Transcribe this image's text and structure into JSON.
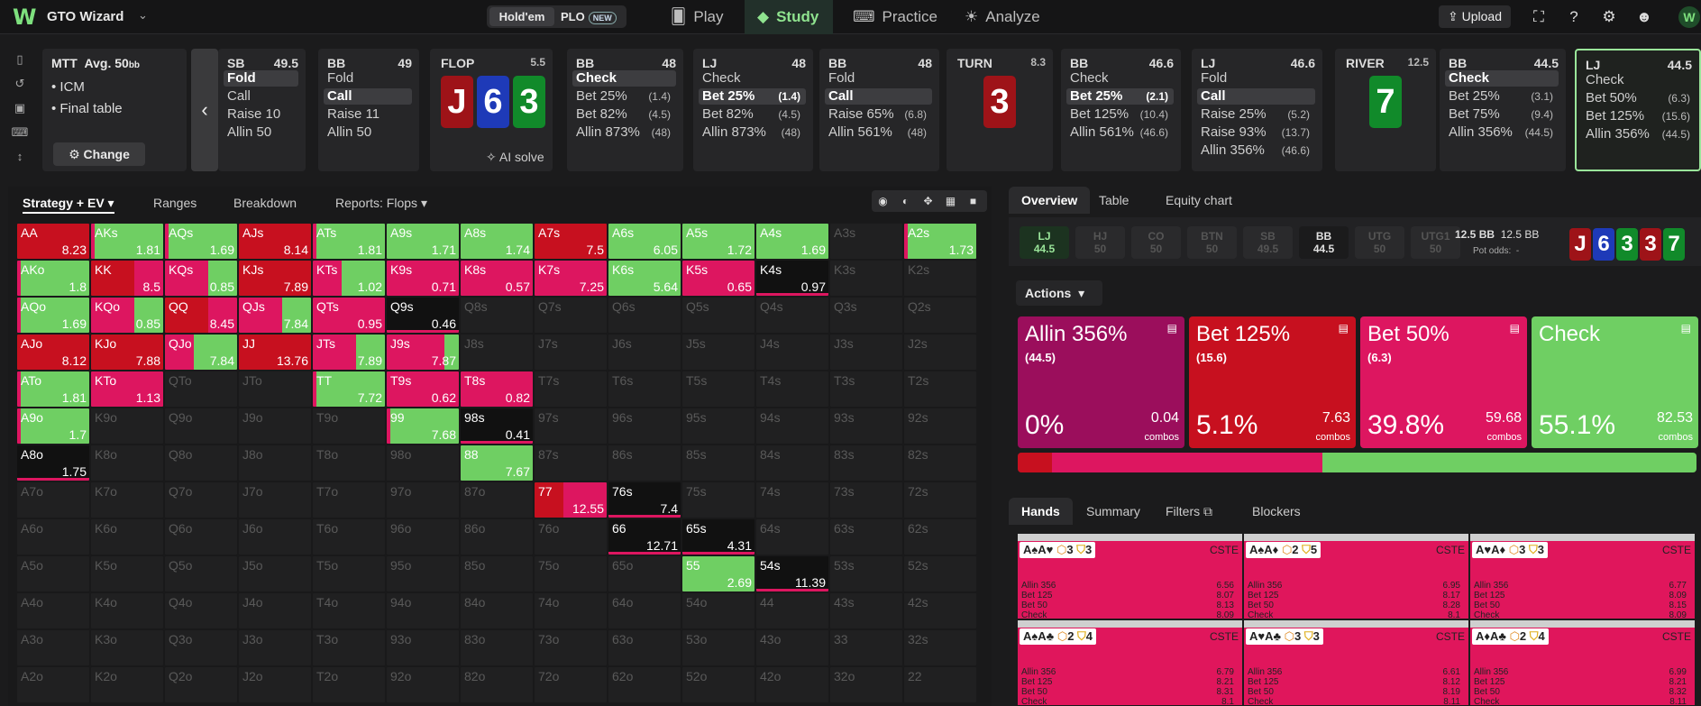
{
  "topbar": {
    "app_title": "GTO Wizard",
    "mode_holdem": "Hold'em",
    "mode_plo": "PLO",
    "new_badge": "NEW",
    "nav": [
      {
        "label": "Play",
        "icon": "cards-icon"
      },
      {
        "label": "Study",
        "icon": "graduation-cap-icon"
      },
      {
        "label": "Practice",
        "icon": "gamepad-icon"
      },
      {
        "label": "Analyze",
        "icon": "lightbulb-icon"
      }
    ],
    "upload": "Upload"
  },
  "mtt": {
    "line1_a": "MTT",
    "line1_b": "Avg. 50",
    "line1_unit": "bb",
    "bullet1": "ICM",
    "bullet2": "Final table",
    "change": "Change"
  },
  "preflop_cards": [
    {
      "name": "SB",
      "stack": "49.5",
      "options": [
        {
          "label": "Fold",
          "amt": "",
          "sel": true
        },
        {
          "label": "Call",
          "amt": "",
          "sel": false
        },
        {
          "label": "Raise 10",
          "amt": "",
          "sel": false
        },
        {
          "label": "Allin 50",
          "amt": "",
          "sel": false
        }
      ]
    },
    {
      "name": "BB",
      "stack": "49",
      "options": [
        {
          "label": "Fold",
          "amt": "",
          "sel": false
        },
        {
          "label": "Call",
          "amt": "",
          "sel": true
        },
        {
          "label": "Raise 11",
          "amt": "",
          "sel": false
        },
        {
          "label": "Allin 50",
          "amt": "",
          "sel": false
        }
      ]
    }
  ],
  "flop": {
    "title": "FLOP",
    "pot": "5.5",
    "cards": [
      "J",
      "6",
      "3"
    ],
    "ai_solve": "AI solve"
  },
  "flop_cards": [
    {
      "name": "BB",
      "stack": "48",
      "options": [
        {
          "label": "Check",
          "amt": "",
          "sel": true
        },
        {
          "label": "Bet 25%",
          "amt": "(1.4)",
          "sel": false
        },
        {
          "label": "Bet 82%",
          "amt": "(4.5)",
          "sel": false
        },
        {
          "label": "Allin 873%",
          "amt": "(48)",
          "sel": false
        }
      ]
    },
    {
      "name": "LJ",
      "stack": "48",
      "options": [
        {
          "label": "Check",
          "amt": "",
          "sel": false
        },
        {
          "label": "Bet 25%",
          "amt": "(1.4)",
          "sel": true
        },
        {
          "label": "Bet 82%",
          "amt": "(4.5)",
          "sel": false
        },
        {
          "label": "Allin 873%",
          "amt": "(48)",
          "sel": false
        }
      ]
    },
    {
      "name": "BB",
      "stack": "48",
      "options": [
        {
          "label": "Fold",
          "amt": "",
          "sel": false
        },
        {
          "label": "Call",
          "amt": "",
          "sel": true
        },
        {
          "label": "Raise 65%",
          "amt": "(6.8)",
          "sel": false
        },
        {
          "label": "Allin 561%",
          "amt": "(48)",
          "sel": false
        }
      ]
    }
  ],
  "turn": {
    "title": "TURN",
    "pot": "8.3",
    "card": "3"
  },
  "turn_cards": [
    {
      "name": "BB",
      "stack": "46.6",
      "options": [
        {
          "label": "Check",
          "amt": "",
          "sel": false
        },
        {
          "label": "Bet 25%",
          "amt": "(2.1)",
          "sel": true
        },
        {
          "label": "Bet 125%",
          "amt": "(10.4)",
          "sel": false
        },
        {
          "label": "Allin 561%",
          "amt": "(46.6)",
          "sel": false
        }
      ]
    },
    {
      "name": "LJ",
      "stack": "46.6",
      "options": [
        {
          "label": "Fold",
          "amt": "",
          "sel": false
        },
        {
          "label": "Call",
          "amt": "",
          "sel": true
        },
        {
          "label": "Raise 25%",
          "amt": "(5.2)",
          "sel": false
        },
        {
          "label": "Raise 93%",
          "amt": "(13.7)",
          "sel": false
        },
        {
          "label": "Allin 356%",
          "amt": "(46.6)",
          "sel": false
        }
      ]
    }
  ],
  "river": {
    "title": "RIVER",
    "pot": "12.5",
    "card": "7"
  },
  "river_cards": [
    {
      "name": "BB",
      "stack": "44.5",
      "options": [
        {
          "label": "Check",
          "amt": "",
          "sel": true
        },
        {
          "label": "Bet 25%",
          "amt": "(3.1)",
          "sel": false
        },
        {
          "label": "Bet 75%",
          "amt": "(9.4)",
          "sel": false
        },
        {
          "label": "Allin 356%",
          "amt": "(44.5)",
          "sel": false
        }
      ]
    },
    {
      "name": "LJ",
      "stack": "44.5",
      "options": [
        {
          "label": "Check",
          "amt": "",
          "sel": false
        },
        {
          "label": "Bet 50%",
          "amt": "(6.3)",
          "sel": false
        },
        {
          "label": "Bet 125%",
          "amt": "(15.6)",
          "sel": false
        },
        {
          "label": "Allin 356%",
          "amt": "(44.5)",
          "sel": false
        }
      ]
    }
  ],
  "left_tabs": {
    "strategy": "Strategy + EV",
    "ranges": "Ranges",
    "breakdown": "Breakdown",
    "reports": "Reports: Flops"
  },
  "grid_ev": {
    "AA": "8.23",
    "AKs": "1.81",
    "AQs": "1.69",
    "AJs": "8.14",
    "ATs": "1.81",
    "A9s": "1.71",
    "A8s": "1.74",
    "A7s": "7.5",
    "A6s": "6.05",
    "A5s": "1.72",
    "A4s": "1.69",
    "A2s": "1.73",
    "AKo": "1.8",
    "KK": "8.5",
    "KQs": "0.85",
    "KJs": "7.89",
    "KTs": "1.02",
    "K9s": "0.71",
    "K8s": "0.57",
    "K7s": "7.25",
    "K6s": "5.64",
    "K5s": "0.65",
    "K4s": "0.97",
    "AQo": "1.69",
    "KQo": "0.85",
    "QQ": "8.45",
    "QJs": "7.84",
    "QTs": "0.95",
    "Q9s": "0.46",
    "AJo": "8.12",
    "KJo": "7.88",
    "QJo": "7.84",
    "JJ": "13.76",
    "JTs": "7.89",
    "J9s": "7.87",
    "ATo": "1.81",
    "KTo": "1.13",
    "TT": "7.72",
    "T9s": "0.62",
    "T8s": "0.82",
    "A9o": "1.7",
    "99": "7.68",
    "98s": "0.41",
    "A8o": "1.75",
    "88": "7.67",
    "77": "12.55",
    "76s": "7.4",
    "66": "12.71",
    "65s": "4.31",
    "55": "2.69",
    "54s": "11.39"
  },
  "grid_mix": {
    "AA": [
      0,
      100,
      0,
      0
    ],
    "AKs": [
      0,
      0,
      5,
      95
    ],
    "AQs": [
      0,
      0,
      5,
      95
    ],
    "AJs": [
      0,
      100,
      0,
      0
    ],
    "ATs": [
      0,
      0,
      5,
      95
    ],
    "A9s": [
      0,
      0,
      0,
      100
    ],
    "A8s": [
      0,
      0,
      0,
      100
    ],
    "A7s": [
      0,
      100,
      0,
      0
    ],
    "A6s": [
      0,
      0,
      0,
      100
    ],
    "A5s": [
      0,
      0,
      0,
      100
    ],
    "A4s": [
      0,
      0,
      0,
      100
    ],
    "A2s": [
      0,
      0,
      5,
      95
    ],
    "AKo": [
      0,
      0,
      5,
      95
    ],
    "KK": [
      0,
      60,
      40,
      0
    ],
    "KQs": [
      0,
      0,
      60,
      40
    ],
    "KJs": [
      0,
      100,
      0,
      0
    ],
    "KTs": [
      0,
      0,
      40,
      60
    ],
    "K9s": [
      0,
      0,
      100,
      0
    ],
    "K8s": [
      0,
      0,
      100,
      0
    ],
    "K7s": [
      0,
      0,
      100,
      0
    ],
    "K6s": [
      0,
      0,
      0,
      100
    ],
    "K5s": [
      0,
      0,
      100,
      0
    ],
    "K4s": [
      0,
      0,
      0,
      0
    ],
    "AQo": [
      0,
      0,
      5,
      95
    ],
    "KQo": [
      0,
      0,
      60,
      40
    ],
    "QQ": [
      0,
      60,
      40,
      0
    ],
    "QJs": [
      0,
      0,
      60,
      40
    ],
    "QTs": [
      0,
      0,
      100,
      0
    ],
    "Q9s": [
      0,
      0,
      0,
      0
    ],
    "AJo": [
      0,
      100,
      0,
      0
    ],
    "KJo": [
      0,
      100,
      0,
      0
    ],
    "QJo": [
      0,
      0,
      40,
      60
    ],
    "JJ": [
      0,
      100,
      0,
      0
    ],
    "JTs": [
      0,
      0,
      60,
      40
    ],
    "J9s": [
      0,
      0,
      80,
      20
    ],
    "ATo": [
      0,
      0,
      5,
      95
    ],
    "KTo": [
      0,
      0,
      100,
      0
    ],
    "TT": [
      0,
      0,
      5,
      95
    ],
    "T9s": [
      0,
      0,
      100,
      0
    ],
    "T8s": [
      0,
      0,
      100,
      0
    ],
    "A9o": [
      0,
      0,
      5,
      95
    ],
    "99": [
      0,
      0,
      5,
      95
    ],
    "98s": [
      0,
      0,
      0,
      0
    ],
    "A8o": [
      0,
      0,
      0,
      0
    ],
    "88": [
      0,
      0,
      0,
      100
    ],
    "77": [
      0,
      40,
      60,
      0
    ],
    "76s": [
      0,
      0,
      0,
      0
    ],
    "66": [
      0,
      0,
      0,
      0
    ],
    "65s": [
      0,
      0,
      0,
      0
    ],
    "55": [
      0,
      0,
      0,
      100
    ],
    "54s": [
      0,
      0,
      0,
      0
    ]
  },
  "right_tabs": {
    "overview": "Overview",
    "table": "Table",
    "equity": "Equity chart"
  },
  "positions": [
    {
      "name": "LJ",
      "stack": "44.5",
      "state": "cur"
    },
    {
      "name": "HJ",
      "stack": "50",
      "state": "def"
    },
    {
      "name": "CO",
      "stack": "50",
      "state": "def"
    },
    {
      "name": "BTN",
      "stack": "50",
      "state": "def"
    },
    {
      "name": "SB",
      "stack": "49.5",
      "state": "def"
    },
    {
      "name": "BB",
      "stack": "44.5",
      "state": "bb"
    },
    {
      "name": "UTG",
      "stack": "50",
      "state": "def"
    },
    {
      "name": "UTG1",
      "stack": "50",
      "state": "def"
    }
  ],
  "pot": {
    "a": "12.5 BB",
    "b": "12.5 BB",
    "odds_label": "Pot odds:",
    "odds_val": "-"
  },
  "board": [
    "J",
    "6",
    "3",
    "3",
    "7"
  ],
  "actions_label": "Actions",
  "actions": [
    {
      "name": "Allin 356%",
      "sub": "(44.5)",
      "freq": "0%",
      "combos": "0.04",
      "color": "#9b0e5c"
    },
    {
      "name": "Bet 125%",
      "sub": "(15.6)",
      "freq": "5.1%",
      "combos": "7.63",
      "color": "#c7101f"
    },
    {
      "name": "Bet 50%",
      "sub": "(6.3)",
      "freq": "39.8%",
      "combos": "59.68",
      "color": "#dd1660"
    },
    {
      "name": "Check",
      "sub": "",
      "freq": "55.1%",
      "combos": "82.53",
      "color": "#6fcf63"
    }
  ],
  "combos_label": "combos",
  "freq_bar": [
    {
      "color": "#9b0e5c",
      "frac": 0
    },
    {
      "color": "#c7101f",
      "frac": 0.051
    },
    {
      "color": "#dd1660",
      "frac": 0.398
    },
    {
      "color": "#6fcf63",
      "frac": 0.551
    }
  ],
  "hand_tabs": {
    "hands": "Hands",
    "summary": "Summary",
    "filters": "Filters",
    "blockers": "Blockers"
  },
  "hands": [
    {
      "cards": "A♠A♥",
      "b1": "3",
      "b2": "3",
      "cste": "CSTE",
      "lines": [
        [
          "Allin 356",
          "6.56"
        ],
        [
          "Bet 125",
          "8.07"
        ],
        [
          "Bet 50",
          "8.13"
        ],
        [
          "Check",
          "8.09"
        ]
      ]
    },
    {
      "cards": "A♠A♦",
      "b1": "2",
      "b2": "5",
      "cste": "CSTE",
      "lines": [
        [
          "Allin 356",
          "6.95"
        ],
        [
          "Bet 125",
          "8.17"
        ],
        [
          "Bet 50",
          "8.28"
        ],
        [
          "Check",
          "8.1"
        ]
      ]
    },
    {
      "cards": "A♥A♦",
      "b1": "3",
      "b2": "3",
      "cste": "CSTE",
      "lines": [
        [
          "Allin 356",
          "6.77"
        ],
        [
          "Bet 125",
          "8.09"
        ],
        [
          "Bet 50",
          "8.15"
        ],
        [
          "Check",
          "8.09"
        ]
      ]
    },
    {
      "cards": "A♠A♣",
      "b1": "2",
      "b2": "4",
      "cste": "CSTE",
      "lines": [
        [
          "Allin 356",
          "6.79"
        ],
        [
          "Bet 125",
          "8.21"
        ],
        [
          "Bet 50",
          "8.31"
        ],
        [
          "Check",
          "8.1"
        ]
      ]
    },
    {
      "cards": "A♥A♣",
      "b1": "3",
      "b2": "3",
      "cste": "CSTE",
      "lines": [
        [
          "Allin 356",
          "6.61"
        ],
        [
          "Bet 125",
          "8.12"
        ],
        [
          "Bet 50",
          "8.19"
        ],
        [
          "Check",
          "8.11"
        ]
      ]
    },
    {
      "cards": "A♦A♣",
      "b1": "2",
      "b2": "4",
      "cste": "CSTE",
      "lines": [
        [
          "Allin 356",
          "6.99"
        ],
        [
          "Bet 125",
          "8.21"
        ],
        [
          "Bet 50",
          "8.32"
        ],
        [
          "Check",
          "8.11"
        ]
      ]
    }
  ]
}
